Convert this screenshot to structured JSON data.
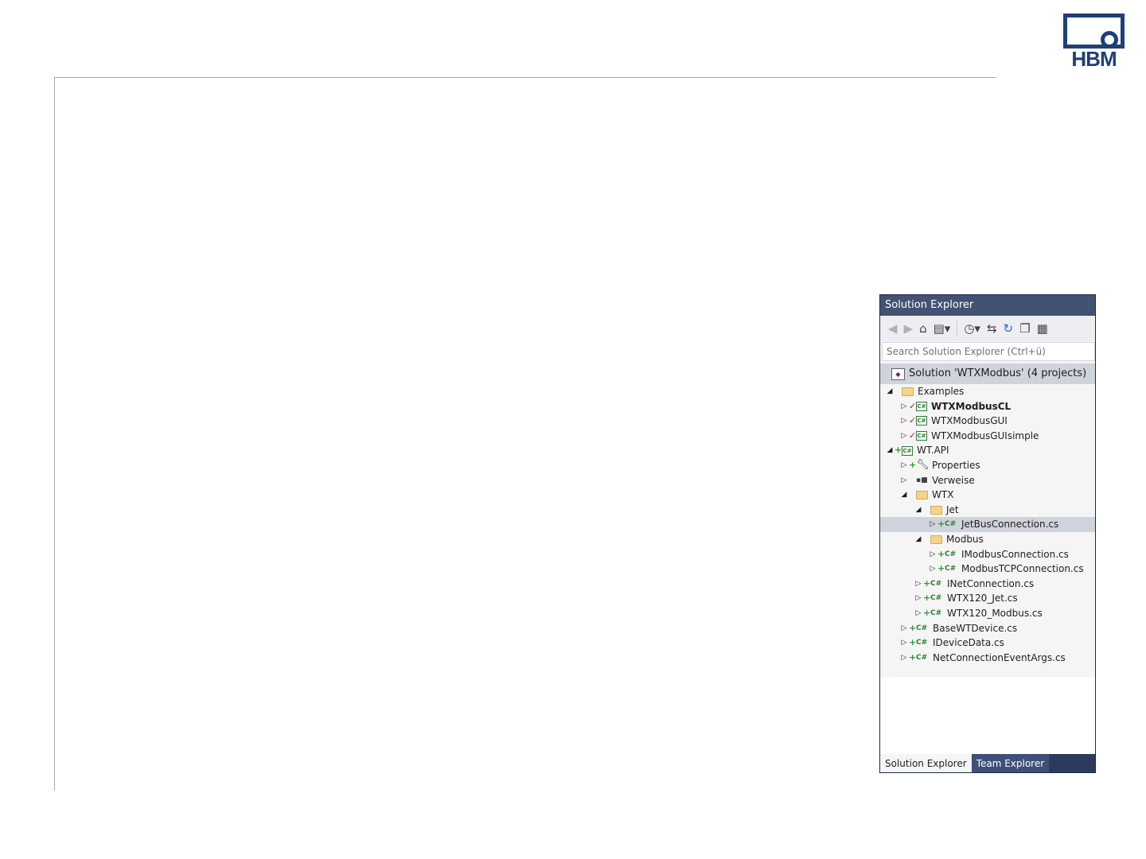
{
  "logo": {
    "text": "HBM"
  },
  "solution_explorer": {
    "title": "Solution Explorer",
    "search_placeholder": "Search Solution Explorer (Ctrl+ü)",
    "solution_label": "Solution 'WTXModbus' (4 projects)",
    "toolbar_icons": [
      "back-icon",
      "forward-icon",
      "home-icon",
      "switch-views-icon",
      "pending-changes-filter-icon",
      "sync-icon",
      "refresh-icon",
      "collapse-all-icon",
      "properties-icon"
    ],
    "tree": [
      {
        "label": "Examples",
        "icon": "folder-icon",
        "expander": "expanded",
        "mark": ""
      },
      {
        "label": "WTXModbusCL",
        "icon": "csharp-project-icon",
        "expander": "collapsed",
        "mark": "check",
        "bold": true
      },
      {
        "label": "WTXModbusGUI",
        "icon": "csharp-project-icon",
        "expander": "collapsed",
        "mark": "check"
      },
      {
        "label": "WTXModbusGUIsimple",
        "icon": "csharp-project-icon",
        "expander": "collapsed",
        "mark": "check"
      },
      {
        "label": "WT.API",
        "icon": "csharp-project-icon",
        "expander": "expanded",
        "mark": "plus"
      },
      {
        "label": "Properties",
        "icon": "wrench-icon",
        "expander": "collapsed",
        "mark": "plus"
      },
      {
        "label": "Verweise",
        "icon": "references-icon",
        "expander": "collapsed",
        "mark": ""
      },
      {
        "label": "WTX",
        "icon": "folder-icon",
        "expander": "expanded",
        "mark": ""
      },
      {
        "label": "Jet",
        "icon": "folder-icon",
        "expander": "expanded",
        "mark": ""
      },
      {
        "label": "JetBusConnection.cs",
        "icon": "csharp-file-icon",
        "expander": "collapsed",
        "mark": "plus",
        "selected": true
      },
      {
        "label": "Modbus",
        "icon": "folder-icon",
        "expander": "expanded",
        "mark": ""
      },
      {
        "label": "IModbusConnection.cs",
        "icon": "csharp-file-icon",
        "expander": "collapsed",
        "mark": "plus"
      },
      {
        "label": "ModbusTCPConnection.cs",
        "icon": "csharp-file-icon",
        "expander": "collapsed",
        "mark": "plus"
      },
      {
        "label": "INetConnection.cs",
        "icon": "csharp-file-icon",
        "expander": "collapsed",
        "mark": "plus"
      },
      {
        "label": "WTX120_Jet.cs",
        "icon": "csharp-file-icon",
        "expander": "collapsed",
        "mark": "plus"
      },
      {
        "label": "WTX120_Modbus.cs",
        "icon": "csharp-file-icon",
        "expander": "collapsed",
        "mark": "plus"
      },
      {
        "label": "BaseWTDevice.cs",
        "icon": "csharp-file-icon",
        "expander": "collapsed",
        "mark": "plus"
      },
      {
        "label": "IDeviceData.cs",
        "icon": "csharp-file-icon",
        "expander": "collapsed",
        "mark": "plus"
      },
      {
        "label": "NetConnectionEventArgs.cs",
        "icon": "csharp-file-icon",
        "expander": "collapsed",
        "mark": "plus"
      }
    ],
    "tabs": [
      "Solution Explorer",
      "Team Explorer"
    ],
    "active_tab": "Solution Explorer"
  },
  "colors": {
    "title_bar": "#435173",
    "selection": "#cfd3dc",
    "logo": "#1e3f78",
    "tab_bar": "#2d3a5b"
  }
}
